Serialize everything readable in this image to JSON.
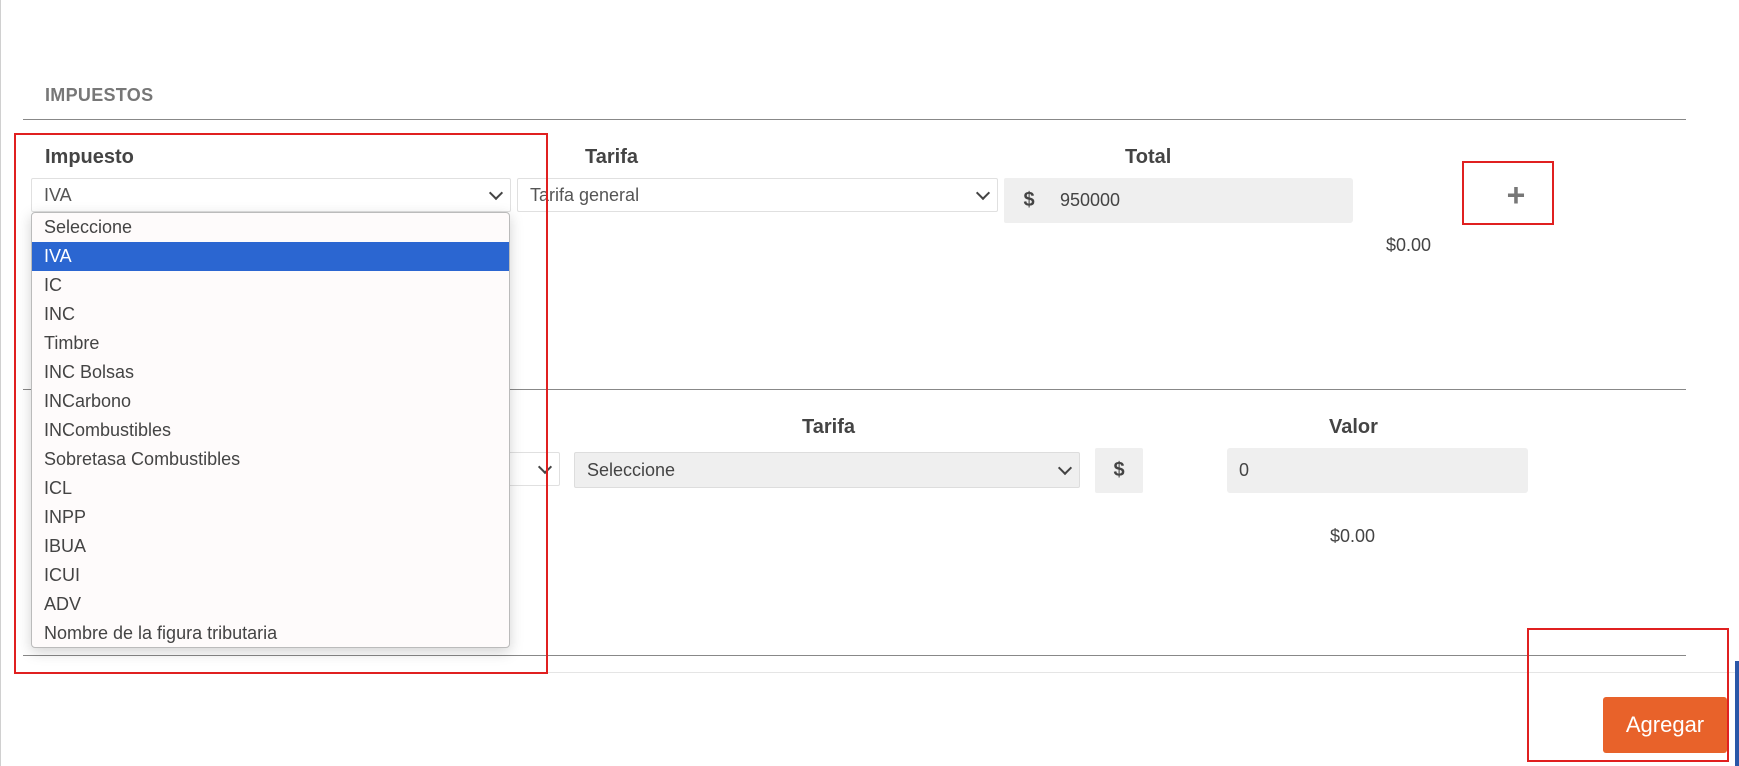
{
  "section": {
    "title": "IMPUESTOS"
  },
  "tax_row": {
    "impuesto_label": "Impuesto",
    "tarifa_label": "Tarifa",
    "total_label": "Total",
    "impuesto_value": "IVA",
    "tarifa_value": "Tarifa general",
    "currency_symbol": "$",
    "total_value": "950000",
    "amount": "$0.00",
    "add_icon": "+"
  },
  "dropdown": {
    "selected": "IVA",
    "options": [
      "Seleccione",
      "IVA",
      "IC",
      "INC",
      "Timbre",
      "INC Bolsas",
      "INCarbono",
      "INCombustibles",
      "Sobretasa Combustibles",
      "ICL",
      "INPP",
      "IBUA",
      "ICUI",
      "ADV",
      "Nombre de la figura tributaria"
    ]
  },
  "second_row": {
    "tarifa_label": "Tarifa",
    "valor_label": "Valor",
    "tarifa_value": "Seleccione",
    "currency_symbol": "$",
    "valor_value": "0",
    "amount": "$0.00"
  },
  "footer": {
    "agregar_label": "Agregar"
  },
  "colors": {
    "selected_option": "#2b66d1",
    "agregar_button": "#e8622a",
    "highlight_box": "#e02020"
  }
}
